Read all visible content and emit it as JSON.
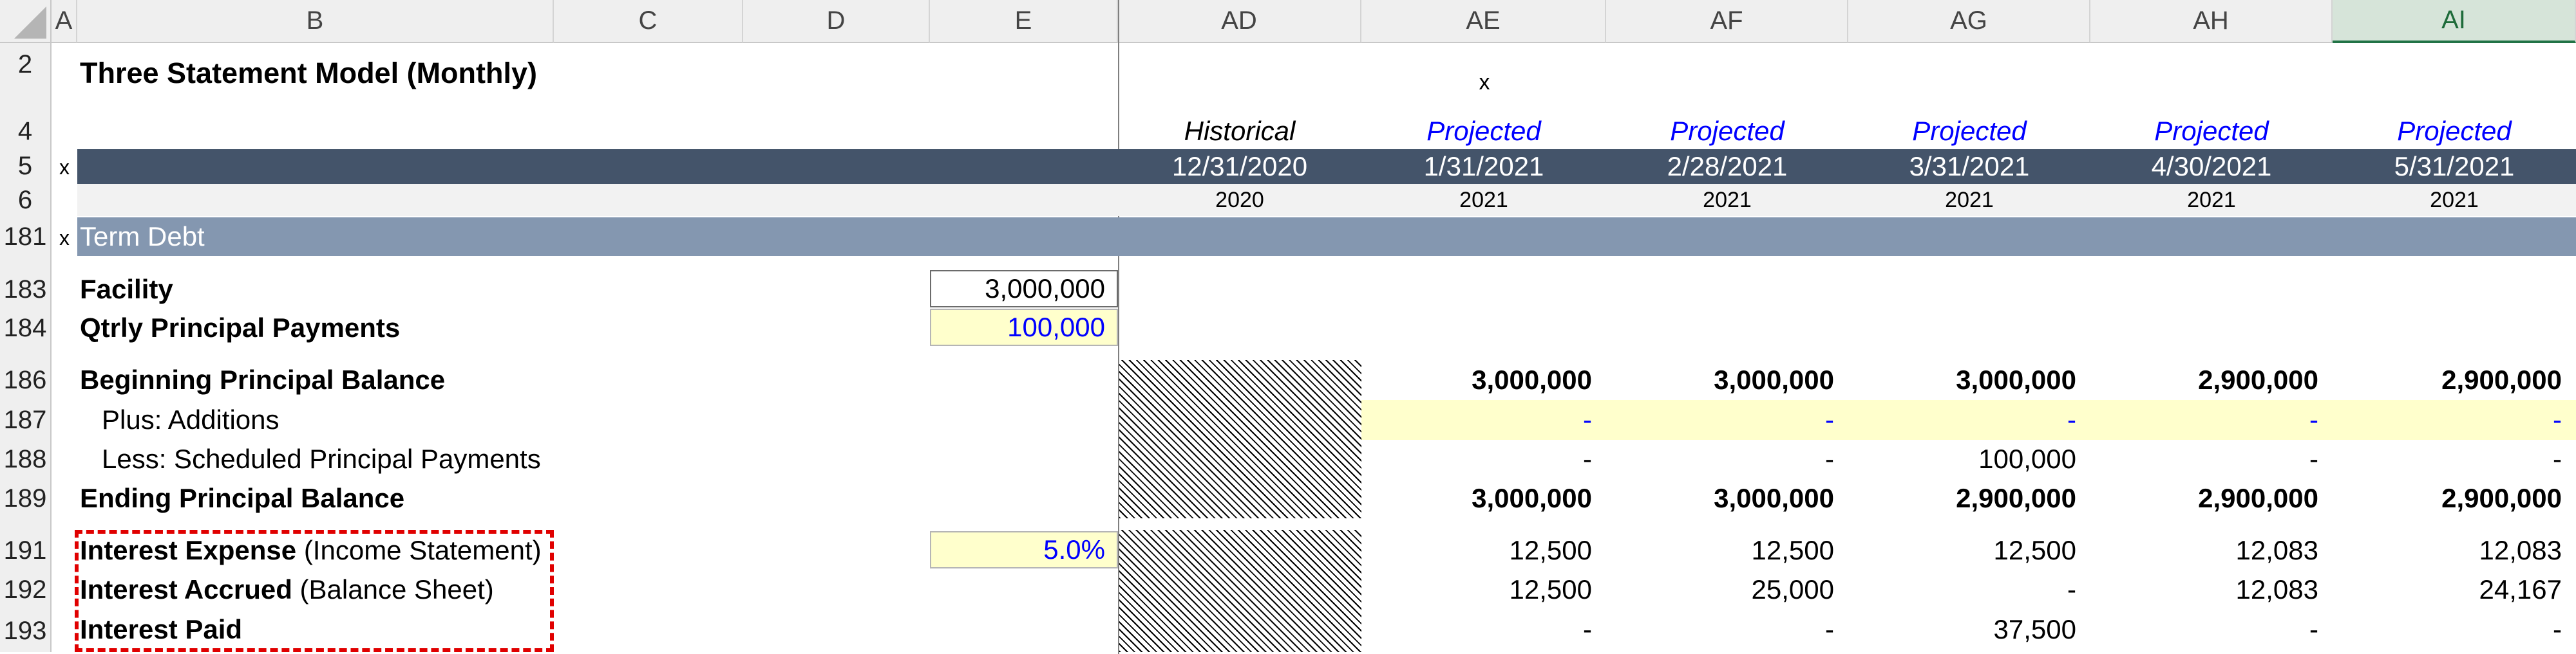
{
  "columns": {
    "left": [
      "A",
      "B",
      "C",
      "D",
      "E"
    ],
    "right": [
      "AD",
      "AE",
      "AF",
      "AG",
      "AH",
      "AI"
    ]
  },
  "rows": {
    "r2": "2",
    "r4": "4",
    "r5": "5",
    "r6": "6",
    "r181": "181",
    "r183": "183",
    "r184": "184",
    "r186": "186",
    "r187": "187",
    "r188": "188",
    "r189": "189",
    "r191": "191",
    "r192": "192",
    "r193": "193"
  },
  "title": "Three Statement Model (Monthly)",
  "marker_x": "x",
  "period_types": [
    "Historical",
    "Projected",
    "Projected",
    "Projected",
    "Projected",
    "Projected"
  ],
  "dates": [
    "12/31/2020",
    "1/31/2021",
    "2/28/2021",
    "3/31/2021",
    "4/30/2021",
    "5/31/2021"
  ],
  "years": [
    "2020",
    "2021",
    "2021",
    "2021",
    "2021",
    "2021"
  ],
  "section_title": "Term Debt",
  "facility": {
    "label": "Facility",
    "value": "3,000,000"
  },
  "qtrly_payments": {
    "label": "Qtrly Principal Payments",
    "value": "100,000"
  },
  "beginning": {
    "label": "Beginning Principal Balance",
    "values": [
      "3,000,000",
      "3,000,000",
      "3,000,000",
      "2,900,000",
      "2,900,000"
    ]
  },
  "additions": {
    "label": "Plus: Additions",
    "values": [
      "-",
      "-",
      "-",
      "-",
      "-"
    ]
  },
  "scheduled": {
    "label": "Less: Scheduled Principal Payments",
    "values": [
      "-",
      "-",
      "100,000",
      "-",
      "-"
    ]
  },
  "ending": {
    "label": "Ending Principal Balance",
    "values": [
      "3,000,000",
      "3,000,000",
      "2,900,000",
      "2,900,000",
      "2,900,000"
    ]
  },
  "interest_expense": {
    "label_bold": "Interest Expense",
    "label_rest": " (Income Statement)",
    "rate": "5.0%",
    "values": [
      "12,500",
      "12,500",
      "12,500",
      "12,083",
      "12,083"
    ]
  },
  "interest_accrued": {
    "label_bold": "Interest Accrued",
    "label_rest": " (Balance Sheet)",
    "values": [
      "12,500",
      "25,000",
      "-",
      "12,083",
      "24,167"
    ]
  },
  "interest_paid": {
    "label_bold": "Interest Paid",
    "values": [
      "-",
      "-",
      "37,500",
      "-",
      "-"
    ]
  },
  "colors": {
    "header_band": "#44546a",
    "section_band": "#8497b0",
    "input_fill": "#ffffcc",
    "input_text": "#0000ff",
    "highlight_border": "#e00000"
  }
}
